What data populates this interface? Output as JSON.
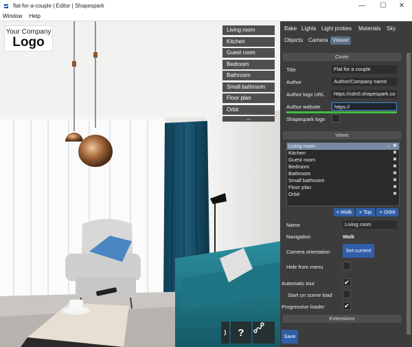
{
  "window": {
    "title": "flat-for-a-couple | Editor | Shapespark",
    "minimize": "—",
    "maximize": "☐",
    "close": "✕"
  },
  "menu": [
    "Window",
    "Help"
  ],
  "logo": {
    "company": "Your Company",
    "word": "Logo"
  },
  "room_menu": {
    "items": [
      "Living room",
      "Kitchen",
      "Guest room",
      "Bedroom",
      "Bathroom",
      "Small bathroom",
      "Floor plan",
      "Orbit"
    ],
    "more": "︿"
  },
  "viewport_buttons": {
    "collapse": "⟩",
    "help": "?",
    "path": "path-icon"
  },
  "tabs": [
    "Bake",
    "Lights",
    "Light probes",
    "Materials",
    "Sky",
    "Objects",
    "Camera",
    "Viewer"
  ],
  "active_tab": "Viewer",
  "cover": {
    "heading": "Cover",
    "title_label": "Title",
    "title_value": "Flat for a couple",
    "author_label": "Author",
    "author_value": "Author/Company name",
    "logo_url_label": "Author logo URL",
    "logo_url_value": "https://cdn0.shapespark.co",
    "website_label": "Author website",
    "website_value": "https://",
    "shapespark_logo_label": "Shapespark logo"
  },
  "views": {
    "heading": "Views",
    "items": [
      "Living room",
      "Kitchen",
      "Guest room",
      "Bedroom",
      "Bathroom",
      "Small bathroom",
      "Floor plan",
      "Orbit"
    ],
    "selected": "Living room",
    "add_walk": "+ Walk",
    "add_top": "+ Top",
    "add_orbit": "+ Orbit",
    "name_label": "Name",
    "name_value": "Living room",
    "navigation_label": "Navigation",
    "navigation_value": "Walk",
    "camera_orientation_label": "Camera orientation",
    "set_current": "Set current",
    "hide_from_menu_label": "Hide from menu"
  },
  "options": {
    "automatic_tour": "Automatic tour",
    "automatic_tour_checked": true,
    "start_on_load": "Start on scene load",
    "start_on_load_checked": false,
    "progressive_loader": "Progressive loader",
    "progressive_loader_checked": true
  },
  "extensions": {
    "heading": "Extensions"
  },
  "save": "Save",
  "check_glyph": "✔",
  "x_glyph": "✖",
  "chevron_glyph": "⌄"
}
